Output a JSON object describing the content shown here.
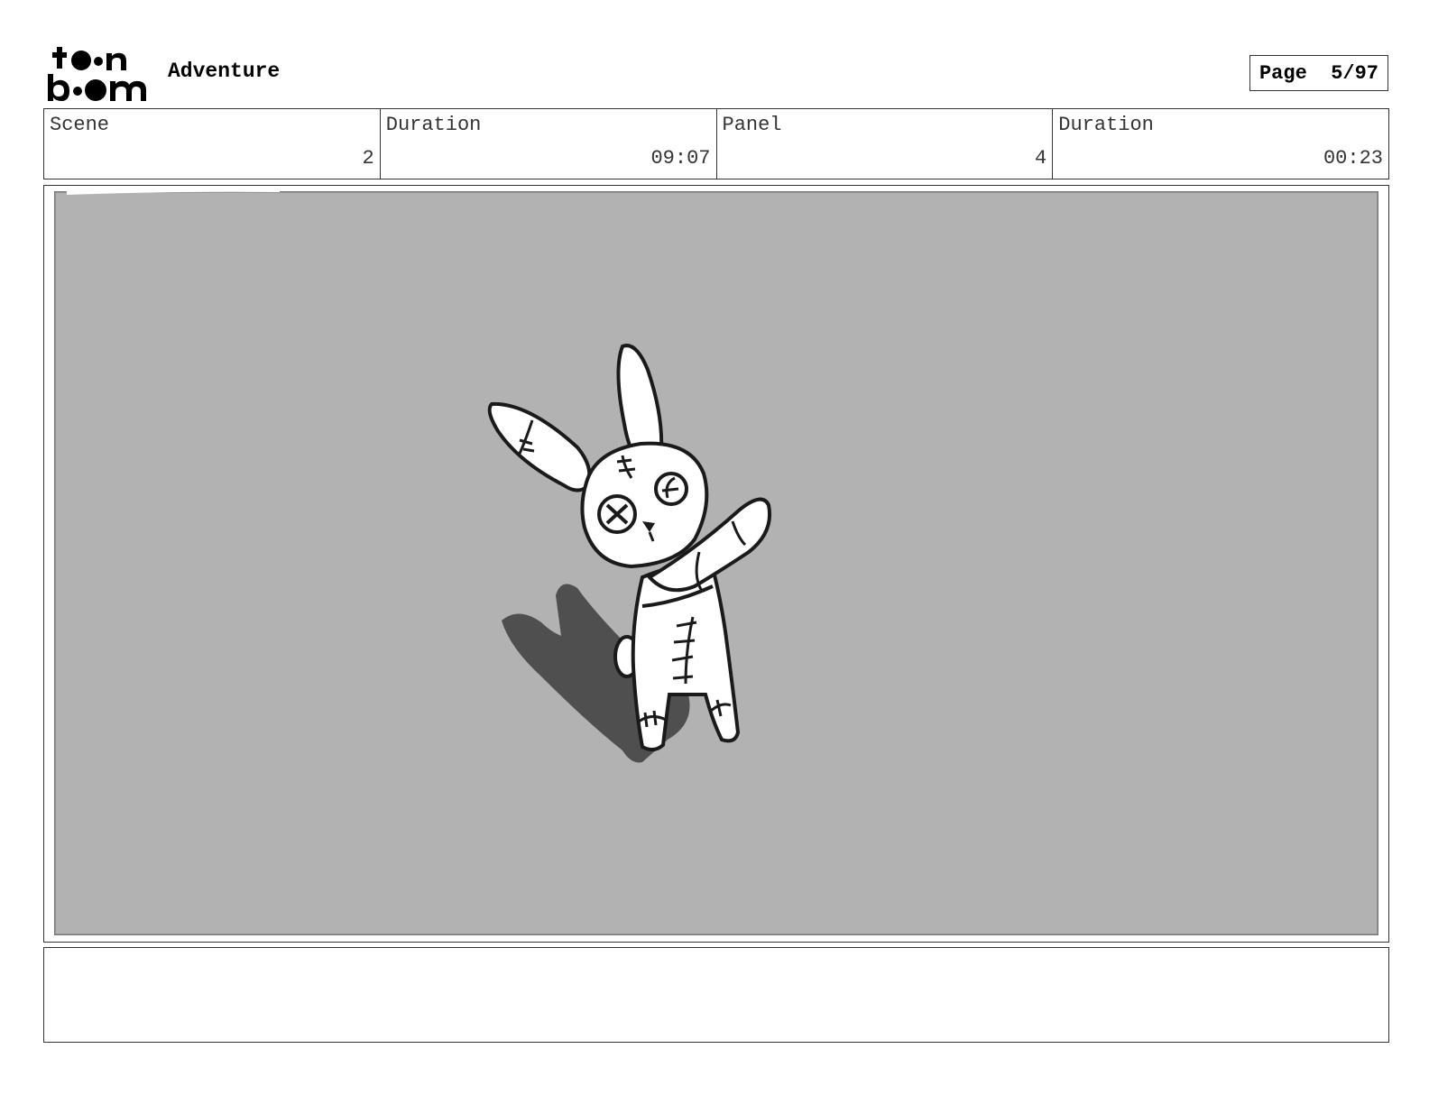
{
  "header": {
    "logo_text": "toon boom",
    "project_title": "Adventure",
    "page_label": "Page",
    "page_number": "5/97"
  },
  "info": {
    "scene_label": "Scene",
    "scene_value": "2",
    "scene_duration_label": "Duration",
    "scene_duration_value": "09:07",
    "panel_label": "Panel",
    "panel_value": "4",
    "panel_duration_label": "Duration",
    "panel_duration_value": "00:23"
  },
  "notes": {
    "text": ""
  },
  "colors": {
    "panel_background": "#b2b2b2",
    "shadow": "#4f4f4f",
    "ink": "#1a1a1a"
  }
}
